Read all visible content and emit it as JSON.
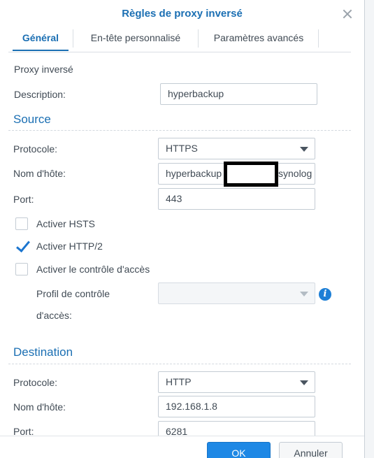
{
  "dialog": {
    "title": "Règles de proxy inversé"
  },
  "tabs": [
    {
      "label": "Général",
      "active": true
    },
    {
      "label": "En-tête personnalisé",
      "active": false
    },
    {
      "label": "Paramètres avancés",
      "active": false
    }
  ],
  "general": {
    "heading": "Proxy inversé",
    "description_label": "Description:",
    "description_value": "hyperbackup"
  },
  "source": {
    "title": "Source",
    "protocol_label": "Protocole:",
    "protocol_value": "HTTPS",
    "hostname_label": "Nom d'hôte:",
    "hostname_prefix": "hyperbackup",
    "hostname_suffix": "synolog",
    "port_label": "Port:",
    "port_value": "443",
    "hsts_label": "Activer HSTS",
    "hsts_checked": false,
    "http2_label": "Activer HTTP/2",
    "http2_checked": true,
    "access_control_label": "Activer le contrôle d'accès",
    "access_control_checked": false,
    "access_profile_label_line1": "Profil de contrôle",
    "access_profile_label_line2": "d'accès:",
    "access_profile_value": ""
  },
  "destination": {
    "title": "Destination",
    "protocol_label": "Protocole:",
    "protocol_value": "HTTP",
    "hostname_label": "Nom d'hôte:",
    "hostname_value": "192.168.1.8",
    "port_label": "Port:",
    "port_value": "6281"
  },
  "footer": {
    "ok_label": "OK",
    "cancel_label": "Annuler"
  },
  "colors": {
    "accent": "#1b6fb3",
    "primary_button": "#1e88e5",
    "check": "#1b75cf"
  },
  "icons": {
    "close": "close-icon",
    "dropdown": "chevron-down-icon",
    "info": "info-icon",
    "check": "checkmark-icon"
  }
}
